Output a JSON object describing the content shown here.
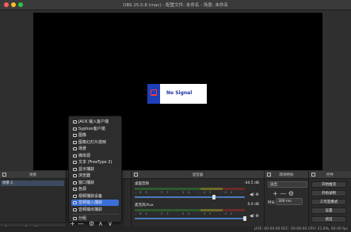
{
  "window": {
    "title": "OBS 25.0.8 (mac) - 配置文件: 未命名 - 场景: 未命名",
    "traffic_lights": [
      "#ff5f57",
      "#febc2e",
      "#28c840"
    ]
  },
  "preview": {
    "no_signal_text": "No Signal"
  },
  "docks": {
    "scenes": {
      "title": "场景",
      "selected_scene": "场景 2",
      "footer": [
        "+",
        "—",
        "∧",
        "∨"
      ]
    },
    "sources": {
      "footer": [
        "+",
        "—",
        "⚙",
        "∧",
        "∨"
      ]
    },
    "mixer": {
      "title": "混音器",
      "channels": [
        {
          "name": "桌面音频",
          "db": "-44.5 dB",
          "level": 0.72
        },
        {
          "name": "麦克风/Aux",
          "db": "0.0 dB",
          "level": 1.0
        }
      ],
      "tick_labels": "-60 -55 -50 -45 -40 -35 -30 -25 -20 -15 -10 -5 0"
    },
    "transitions": {
      "title": "转场特效",
      "selected": "淡出",
      "duration_label": "时长",
      "duration_value": "300 ms"
    },
    "controls": {
      "title": "控件",
      "buttons": [
        "开始推流",
        "开始录制",
        "工作室模式",
        "设置",
        "退出"
      ]
    }
  },
  "context_menu": {
    "items": [
      {
        "label": "JACK 输入客户端",
        "icon": "speaker-icon"
      },
      {
        "label": "Syphon客户端",
        "icon": "video-icon"
      },
      {
        "label": "图像",
        "icon": "image-icon"
      },
      {
        "label": "图像幻灯片放映",
        "icon": "slideshow-icon"
      },
      {
        "label": "场景",
        "icon": "scene-icon"
      },
      {
        "label": "媒体源",
        "icon": "play-icon"
      },
      {
        "label": "文本 (FreeType 2)",
        "icon": "text-icon"
      },
      {
        "label": "显示捕获",
        "icon": "monitor-icon"
      },
      {
        "label": "浏览器",
        "icon": "globe-icon"
      },
      {
        "label": "窗口捕获",
        "icon": "window-icon"
      },
      {
        "label": "色源",
        "icon": "palette-icon"
      },
      {
        "label": "视频捕获设备",
        "icon": "camera-icon"
      },
      {
        "label": "音频输入捕获",
        "icon": "microphone-icon"
      },
      {
        "label": "音频输出捕获",
        "icon": "speaker-icon"
      },
      {
        "label": "分组",
        "icon": "folder-icon"
      }
    ],
    "selected_index": 12
  },
  "status": {
    "text": "LIVE: 00:00:00   REC: 00:00:00   CPU: 21.8%, 60.00 fps"
  }
}
